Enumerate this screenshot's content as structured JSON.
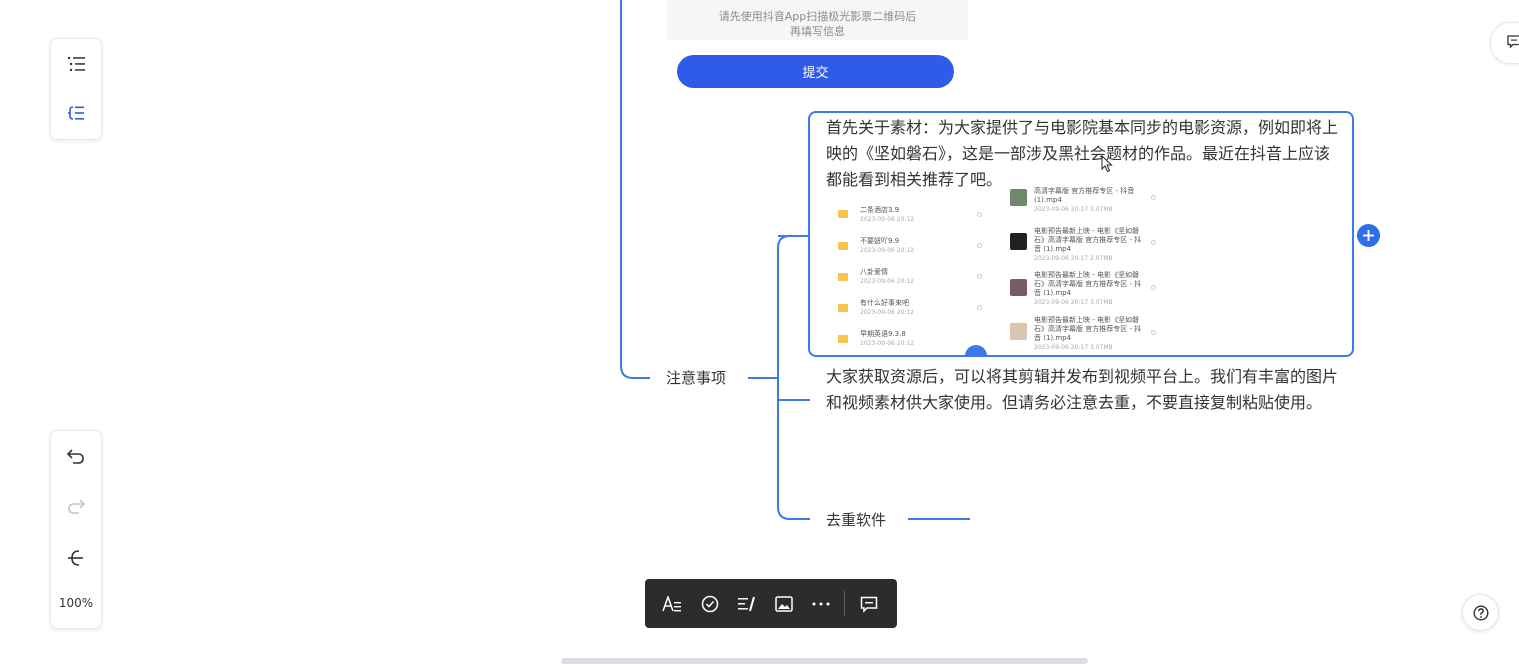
{
  "phone_card": {
    "hint_line1": "请先使用抖音App扫描极光影票二维码后",
    "hint_line2": "再填写信息",
    "submit_label": "提交"
  },
  "nodes": {
    "selected_text": "首先关于素材：为大家提供了与电影院基本同步的电影资源，例如即将上映的《坚如磐石》，这是一部涉及黑社会题材的作品。最近在抖音上应该都能看到相关推荐了吧。",
    "notice_topic": "注意事项",
    "usage_text": "大家获取资源后，可以将其剪辑并发布到视频平台上。我们有丰富的图片和视频素材供大家使用。但请务必注意去重，不要直接复制粘贴使用。",
    "dedupe_topic": "去重软件"
  },
  "file_list": {
    "folders": [
      {
        "name": "二条酒店3.9",
        "meta": "2023-09-06 20:12"
      },
      {
        "name": "不要妞吖9.9",
        "meta": "2023-09-06 20:12"
      },
      {
        "name": "八卦爱情",
        "meta": "2023-09-06 20:12"
      },
      {
        "name": "有什么好事来吧",
        "meta": "2023-09-06 20:12"
      },
      {
        "name": "早期英语9.3.8",
        "meta": "2023-09-06 20:12"
      }
    ],
    "videos": [
      {
        "name": "高清字幕版 官方推荐专区 - 抖音 (1).mp4",
        "meta": "2023-09-06 20:17 3.07MB"
      },
      {
        "name": "电影预告最新上映 - 电影《坚如磐石》高清字幕版 官方推荐专区 - 抖音 (1).mp4",
        "meta": "2023-09-06 20:17 2.07MB"
      },
      {
        "name": "电影预告最新上映 - 电影《坚如磐石》高清字幕版 官方推荐专区 - 抖音 (1).mp4",
        "meta": "2023-09-06 20:17 3.07MB"
      },
      {
        "name": "电影预告最新上映 - 电影《坚如磐石》高清字幕版 官方推荐专区 - 抖音 (1).mp4",
        "meta": "2023-09-06 20:17 3.07MB"
      }
    ]
  },
  "zoom": "100%",
  "colors": {
    "accent": "#3d79e8",
    "submit": "#2f5bea",
    "toolbar_bg": "#2b2c2e",
    "connector": "#3d79e8"
  }
}
